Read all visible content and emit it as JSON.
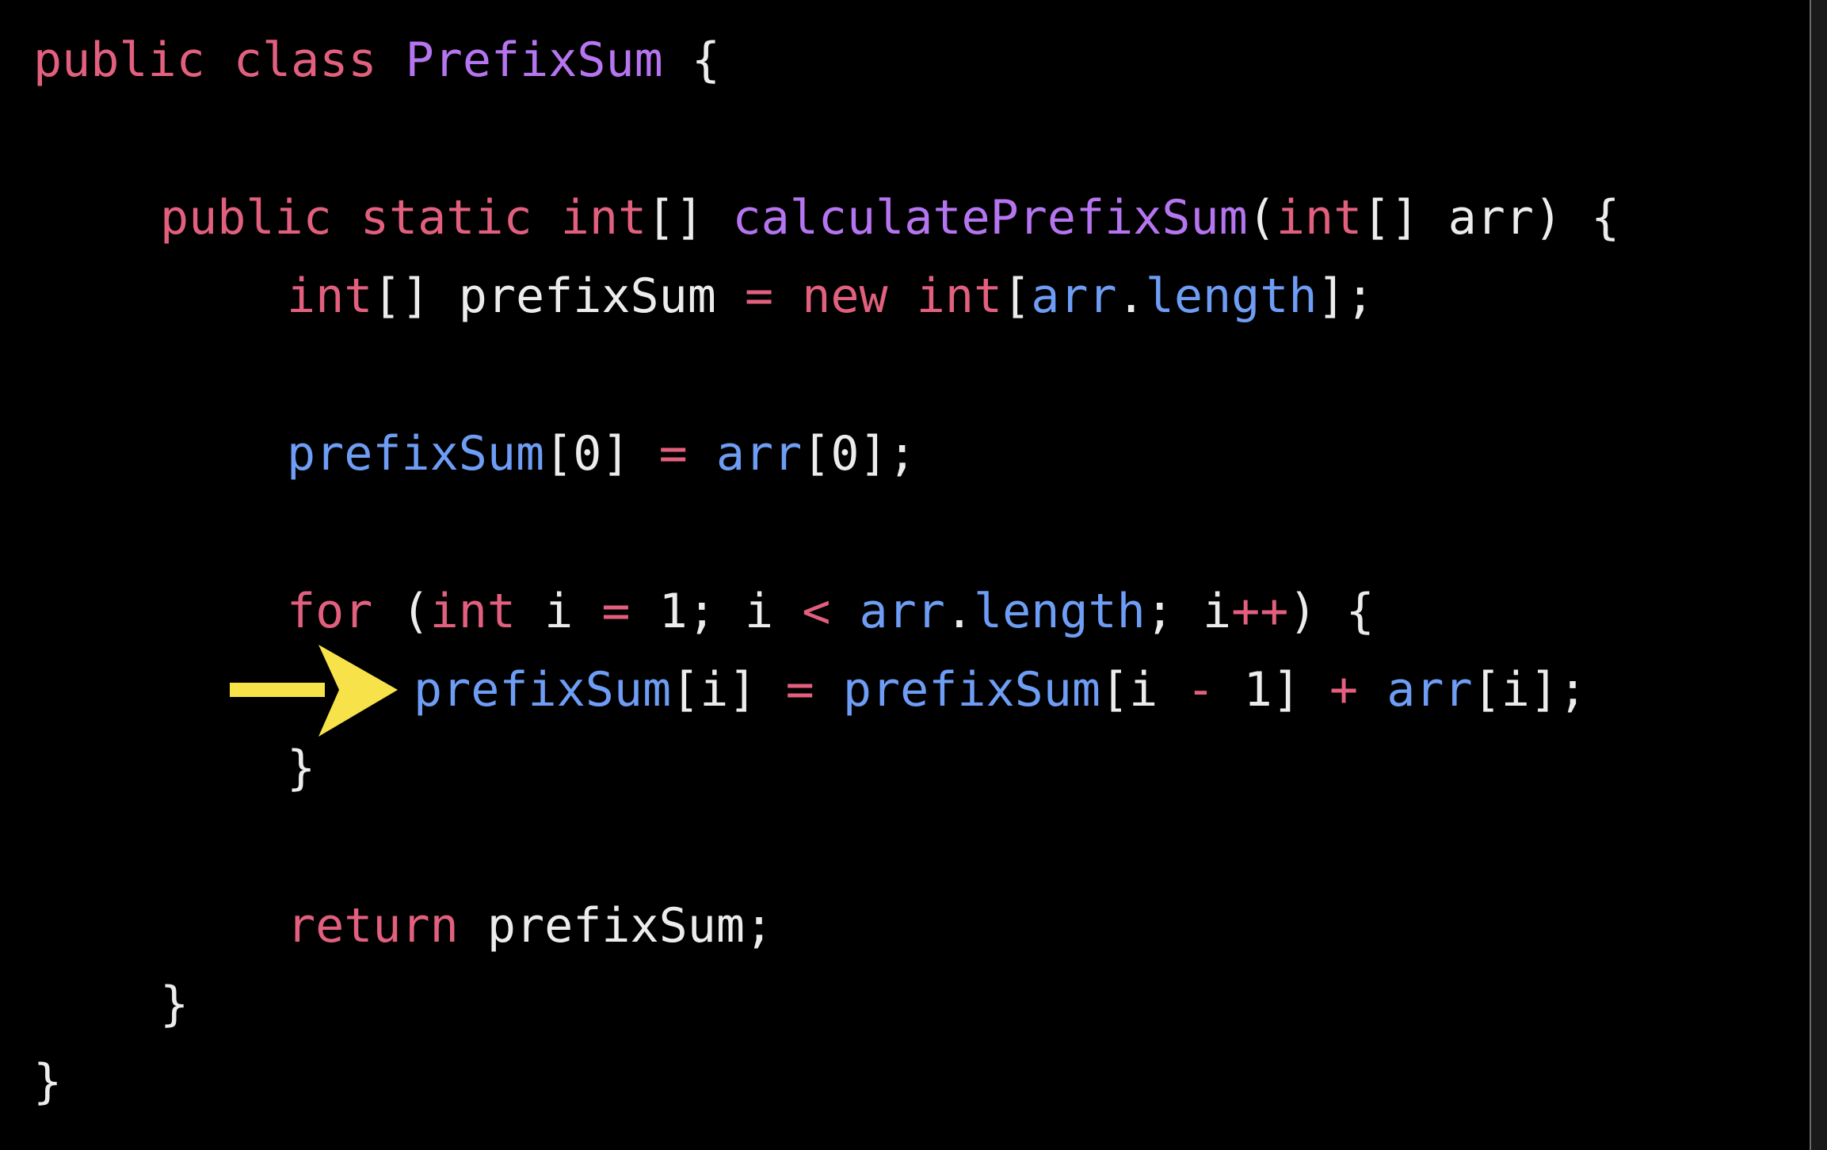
{
  "colors": {
    "background": "#000000",
    "keyword": "#e2607e",
    "type_name": "#b675f0",
    "variable": "#6e9df5",
    "punctuation": "#ececec",
    "operator": "#e2607e",
    "arrow": "#f8e24a"
  },
  "marker": {
    "icon": "arrow-right-icon",
    "line_index": 9,
    "color": "#f8e24a"
  },
  "code": {
    "language": "java",
    "lines": [
      {
        "indent": 0,
        "tokens": [
          {
            "t": "public",
            "k": "keyword"
          },
          {
            "t": " ",
            "k": "punctuation"
          },
          {
            "t": "class",
            "k": "keyword"
          },
          {
            "t": " ",
            "k": "punctuation"
          },
          {
            "t": "PrefixSum",
            "k": "type_name"
          },
          {
            "t": " {",
            "k": "punctuation"
          }
        ]
      },
      {
        "indent": 4,
        "tokens": [
          {
            "t": "public",
            "k": "keyword"
          },
          {
            "t": " ",
            "k": "punctuation"
          },
          {
            "t": "static",
            "k": "keyword"
          },
          {
            "t": " ",
            "k": "punctuation"
          },
          {
            "t": "int",
            "k": "keyword"
          },
          {
            "t": "[] ",
            "k": "punctuation"
          },
          {
            "t": "calculatePrefixSum",
            "k": "type_name"
          },
          {
            "t": "(",
            "k": "punctuation"
          },
          {
            "t": "int",
            "k": "keyword"
          },
          {
            "t": "[] arr) {",
            "k": "punctuation"
          }
        ]
      },
      {
        "indent": 8,
        "tokens": [
          {
            "t": "int",
            "k": "keyword"
          },
          {
            "t": "[] prefixSum ",
            "k": "punctuation"
          },
          {
            "t": "=",
            "k": "operator"
          },
          {
            "t": " ",
            "k": "punctuation"
          },
          {
            "t": "new",
            "k": "keyword"
          },
          {
            "t": " ",
            "k": "punctuation"
          },
          {
            "t": "int",
            "k": "keyword"
          },
          {
            "t": "[",
            "k": "punctuation"
          },
          {
            "t": "arr",
            "k": "variable"
          },
          {
            "t": ".",
            "k": "punctuation"
          },
          {
            "t": "length",
            "k": "variable"
          },
          {
            "t": "];",
            "k": "punctuation"
          }
        ]
      },
      {
        "indent": 8,
        "tokens": [
          {
            "t": "prefixSum",
            "k": "variable"
          },
          {
            "t": "[0] ",
            "k": "punctuation"
          },
          {
            "t": "=",
            "k": "operator"
          },
          {
            "t": " ",
            "k": "punctuation"
          },
          {
            "t": "arr",
            "k": "variable"
          },
          {
            "t": "[0];",
            "k": "punctuation"
          }
        ]
      },
      {
        "indent": 8,
        "tokens": [
          {
            "t": "for",
            "k": "keyword"
          },
          {
            "t": " (",
            "k": "punctuation"
          },
          {
            "t": "int",
            "k": "keyword"
          },
          {
            "t": " i ",
            "k": "punctuation"
          },
          {
            "t": "=",
            "k": "operator"
          },
          {
            "t": " 1; i ",
            "k": "punctuation"
          },
          {
            "t": "<",
            "k": "operator"
          },
          {
            "t": " ",
            "k": "punctuation"
          },
          {
            "t": "arr",
            "k": "variable"
          },
          {
            "t": ".",
            "k": "punctuation"
          },
          {
            "t": "length",
            "k": "variable"
          },
          {
            "t": "; i",
            "k": "punctuation"
          },
          {
            "t": "++",
            "k": "operator"
          },
          {
            "t": ") {",
            "k": "punctuation"
          }
        ]
      },
      {
        "indent": 12,
        "tokens": [
          {
            "t": "prefixSum",
            "k": "variable"
          },
          {
            "t": "[i] ",
            "k": "punctuation"
          },
          {
            "t": "=",
            "k": "operator"
          },
          {
            "t": " ",
            "k": "punctuation"
          },
          {
            "t": "prefixSum",
            "k": "variable"
          },
          {
            "t": "[i ",
            "k": "punctuation"
          },
          {
            "t": "-",
            "k": "operator"
          },
          {
            "t": " 1] ",
            "k": "punctuation"
          },
          {
            "t": "+",
            "k": "operator"
          },
          {
            "t": " ",
            "k": "punctuation"
          },
          {
            "t": "arr",
            "k": "variable"
          },
          {
            "t": "[i];",
            "k": "punctuation"
          }
        ]
      },
      {
        "indent": 8,
        "tokens": [
          {
            "t": "}",
            "k": "punctuation"
          }
        ]
      },
      {
        "indent": 8,
        "tokens": [
          {
            "t": "return",
            "k": "keyword"
          },
          {
            "t": " prefixSum;",
            "k": "punctuation"
          }
        ]
      },
      {
        "indent": 4,
        "tokens": [
          {
            "t": "}",
            "k": "punctuation"
          }
        ]
      },
      {
        "indent": 0,
        "tokens": [
          {
            "t": "}",
            "k": "punctuation"
          }
        ]
      }
    ]
  }
}
